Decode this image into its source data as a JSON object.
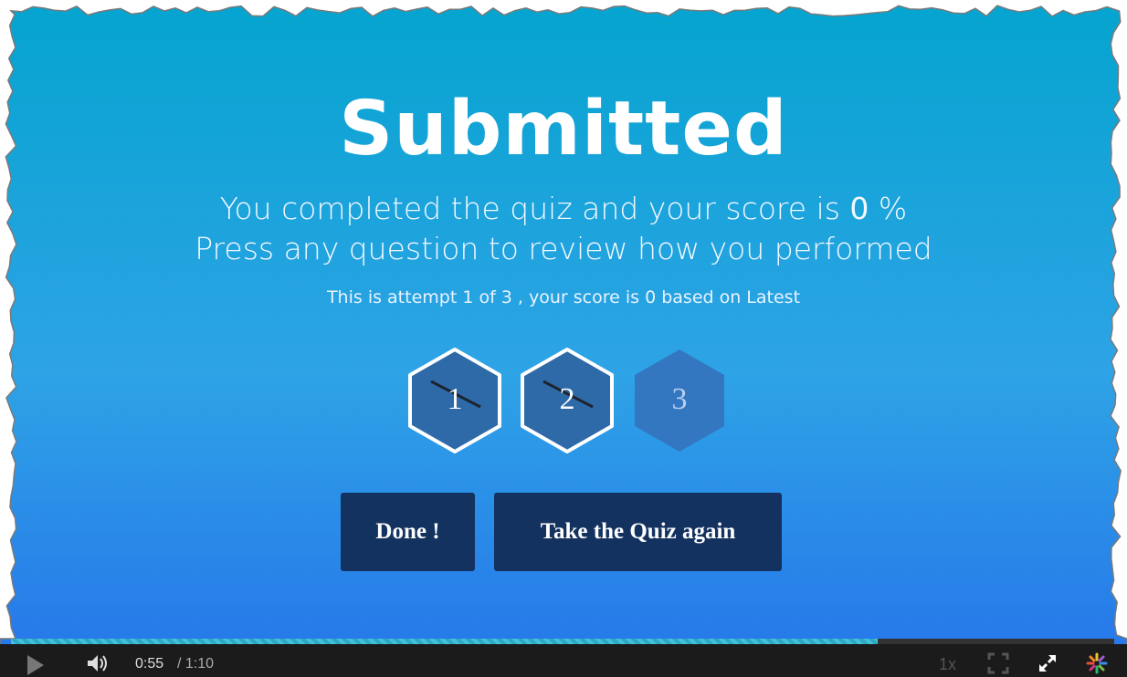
{
  "quiz": {
    "title": "Submitted",
    "score_prefix": "You completed the quiz and your score is ",
    "score_value": "0",
    "score_suffix": " %",
    "review_text": "Press any question to review how you performed",
    "attempt_text": "This is attempt 1 of 3 , your score is 0 based on Latest"
  },
  "questions": [
    {
      "label": "1",
      "status": "incorrect"
    },
    {
      "label": "2",
      "status": "incorrect"
    },
    {
      "label": "3",
      "status": "unanswered"
    }
  ],
  "buttons": {
    "done": "Done !",
    "retake": "Take the Quiz again"
  },
  "player": {
    "current_time": "0:55",
    "total_time": "/ 1:10",
    "progress_fraction": 0.786,
    "speed": "1x"
  },
  "colors": {
    "background_top": "#05a4cf",
    "background_bottom": "#2674ea",
    "button_bg": "#14325f",
    "hex_fill": "#2e6aa8",
    "hex_fill_dim": "#3377c0",
    "progress_color": "#42c2d8"
  },
  "icons": {
    "play": "play-icon",
    "volume": "volume-icon",
    "fullscreen": "fullscreen-icon",
    "expand": "expand-icon",
    "logo": "spark-logo-icon"
  }
}
